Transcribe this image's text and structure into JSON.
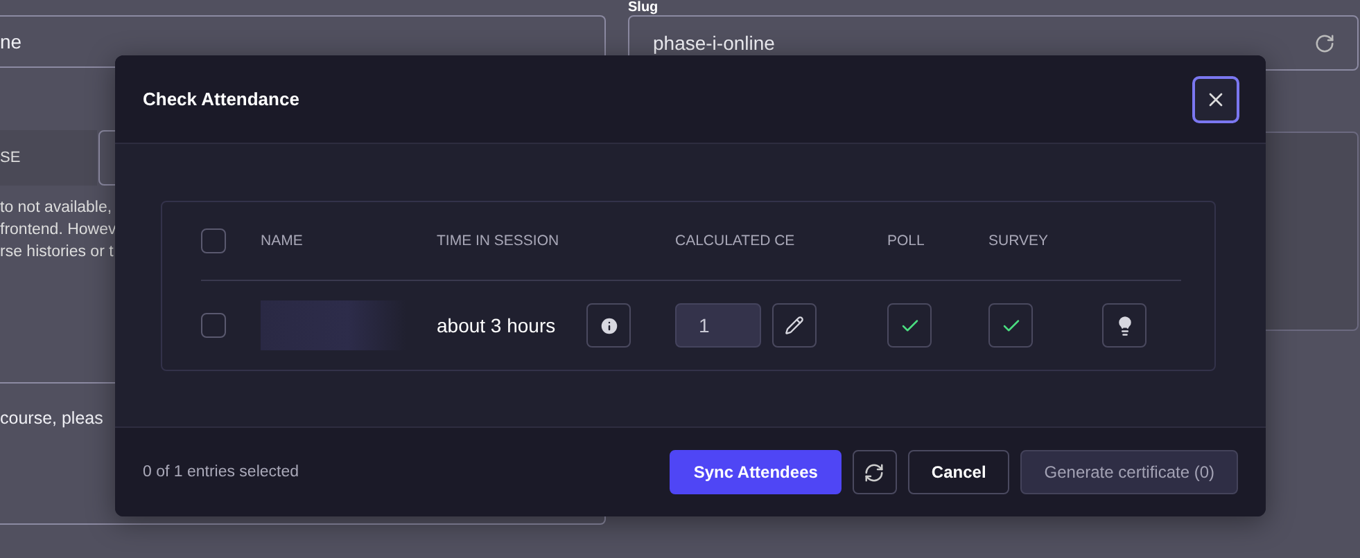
{
  "background": {
    "left_field": {
      "value": "ne"
    },
    "option_label": "SE",
    "help_lines": [
      "to not available,",
      "frontend. Howev",
      "rse histories or t"
    ],
    "note_field": {
      "value": "course, pleas"
    },
    "slug": {
      "label": "Slug",
      "value": "phase-i-online"
    }
  },
  "modal": {
    "title": "Check Attendance",
    "table": {
      "columns": [
        "NAME",
        "TIME IN SESSION",
        "CALCULATED CE",
        "POLL",
        "SURVEY"
      ],
      "select_all_checked": false,
      "rows": [
        {
          "checked": false,
          "time": "about 3 hours",
          "ce": "1",
          "poll": true,
          "survey": true
        }
      ]
    },
    "footer": {
      "selection": "0 of 1 entries selected",
      "buttons": [
        {
          "kind": "primary",
          "label": "Sync Attendees"
        },
        {
          "kind": "icon"
        },
        {
          "kind": "secondary",
          "label": "Cancel"
        },
        {
          "kind": "disabled",
          "label": "Generate certificate (0)"
        }
      ]
    }
  }
}
